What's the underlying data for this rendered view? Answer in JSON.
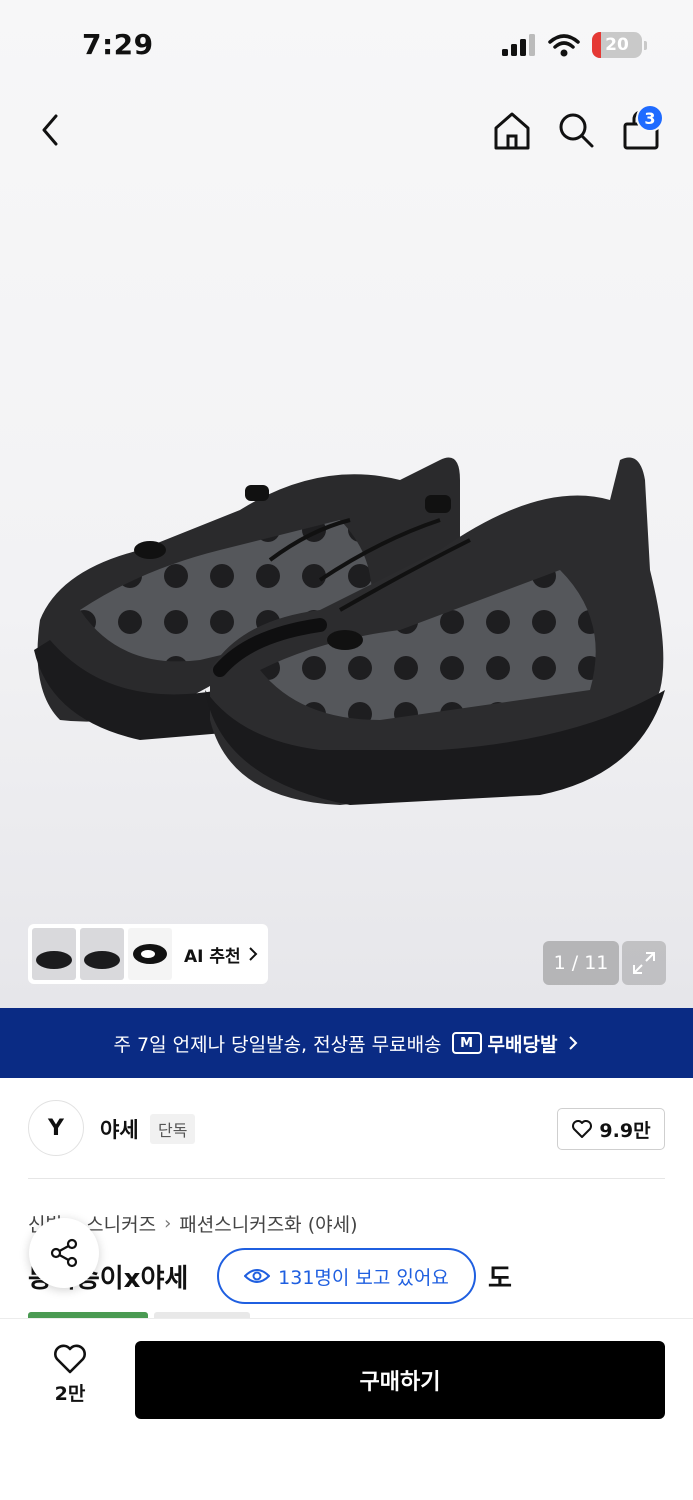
{
  "status_bar": {
    "time": "7:29",
    "battery": "20"
  },
  "nav": {
    "back_icon": "chevron-left-icon",
    "home_icon": "home-icon",
    "search_icon": "search-icon",
    "cart_icon": "shopping-bag-icon",
    "cart_count": "3"
  },
  "gallery": {
    "ai_label": "AI 추천",
    "page_indicator": "1 / 11",
    "expand_icon": "expand-icon"
  },
  "banner": {
    "text": "주 7일 언제나 당일발송, 전상품 무료배송",
    "badge_mark": "M",
    "badge_label": "무배당발"
  },
  "brand": {
    "logo_text": "Y",
    "name": "야세",
    "tag": "단독",
    "like_count": "9.9만"
  },
  "breadcrumb": [
    "신발",
    "스니커즈",
    "패션스니커즈화 (야세)"
  ],
  "product": {
    "title_visible": "몽키송이x야세",
    "title_tail": "도"
  },
  "viewers": {
    "text": "131명이 보고 있어요"
  },
  "bottom": {
    "wish_count": "2만",
    "buy_label": "구매하기"
  },
  "colors": {
    "brand_navy": "#0a2b84",
    "accent_blue": "#1f5fe0",
    "badge_blue": "#1f6bff",
    "buy_black": "#000000"
  }
}
